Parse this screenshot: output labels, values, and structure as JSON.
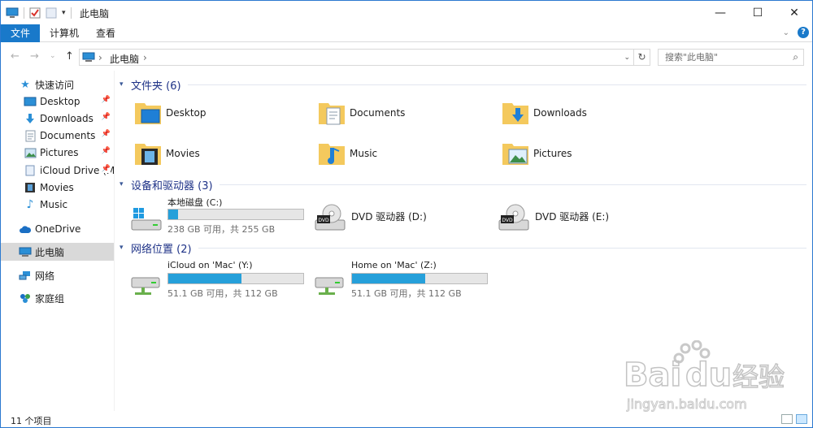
{
  "window": {
    "title": "此电脑"
  },
  "ribbon": {
    "tabs": [
      {
        "label": "文件"
      },
      {
        "label": "计算机"
      },
      {
        "label": "查看"
      }
    ]
  },
  "address": {
    "crumbs": [
      "此电脑"
    ]
  },
  "search": {
    "placeholder": "搜索\"此电脑\""
  },
  "navpane": {
    "quick_access": "快速访问",
    "items": [
      {
        "label": "Desktop",
        "icon": "desktop-icon",
        "pinned": true
      },
      {
        "label": "Downloads",
        "icon": "downloads-icon",
        "pinned": true
      },
      {
        "label": "Documents",
        "icon": "documents-icon",
        "pinned": true
      },
      {
        "label": "Pictures",
        "icon": "pictures-icon",
        "pinned": true
      },
      {
        "label": "iCloud Drive (M",
        "icon": "icloud-drive-icon",
        "pinned": true
      },
      {
        "label": "Movies",
        "icon": "movies-icon",
        "pinned": false
      },
      {
        "label": "Music",
        "icon": "music-icon",
        "pinned": false
      }
    ],
    "onedrive": "OneDrive",
    "this_pc": "此电脑",
    "network": "网络",
    "homegroup": "家庭组"
  },
  "groups": {
    "folders": {
      "title": "文件夹 (6)",
      "items": [
        {
          "label": "Desktop"
        },
        {
          "label": "Documents"
        },
        {
          "label": "Downloads"
        },
        {
          "label": "Movies"
        },
        {
          "label": "Music"
        },
        {
          "label": "Pictures"
        }
      ]
    },
    "devices": {
      "title": "设备和驱动器 (3)",
      "items": [
        {
          "label": "本地磁盘 (C:)",
          "free": "238 GB 可用，共 255 GB",
          "used_fraction": 0.07
        },
        {
          "label": "DVD 驱动器 (D:)"
        },
        {
          "label": "DVD 驱动器 (E:)"
        }
      ]
    },
    "network": {
      "title": "网络位置 (2)",
      "items": [
        {
          "label": "iCloud on 'Mac' (Y:)",
          "free": "51.1 GB 可用，共 112 GB",
          "used_fraction": 0.54
        },
        {
          "label": "Home on 'Mac' (Z:)",
          "free": "51.1 GB 可用，共 112 GB",
          "used_fraction": 0.54
        }
      ]
    }
  },
  "status": {
    "count": "11 个项目"
  },
  "watermark": {
    "brand": "Bai",
    "brand_end": "du",
    "cn": "经验",
    "url": "jingyan.baidu.com"
  },
  "colors": {
    "accent": "#1979ca",
    "bar_fill": "#26a0da",
    "group_title": "#1e3287",
    "selected": "#d9d9d9"
  }
}
